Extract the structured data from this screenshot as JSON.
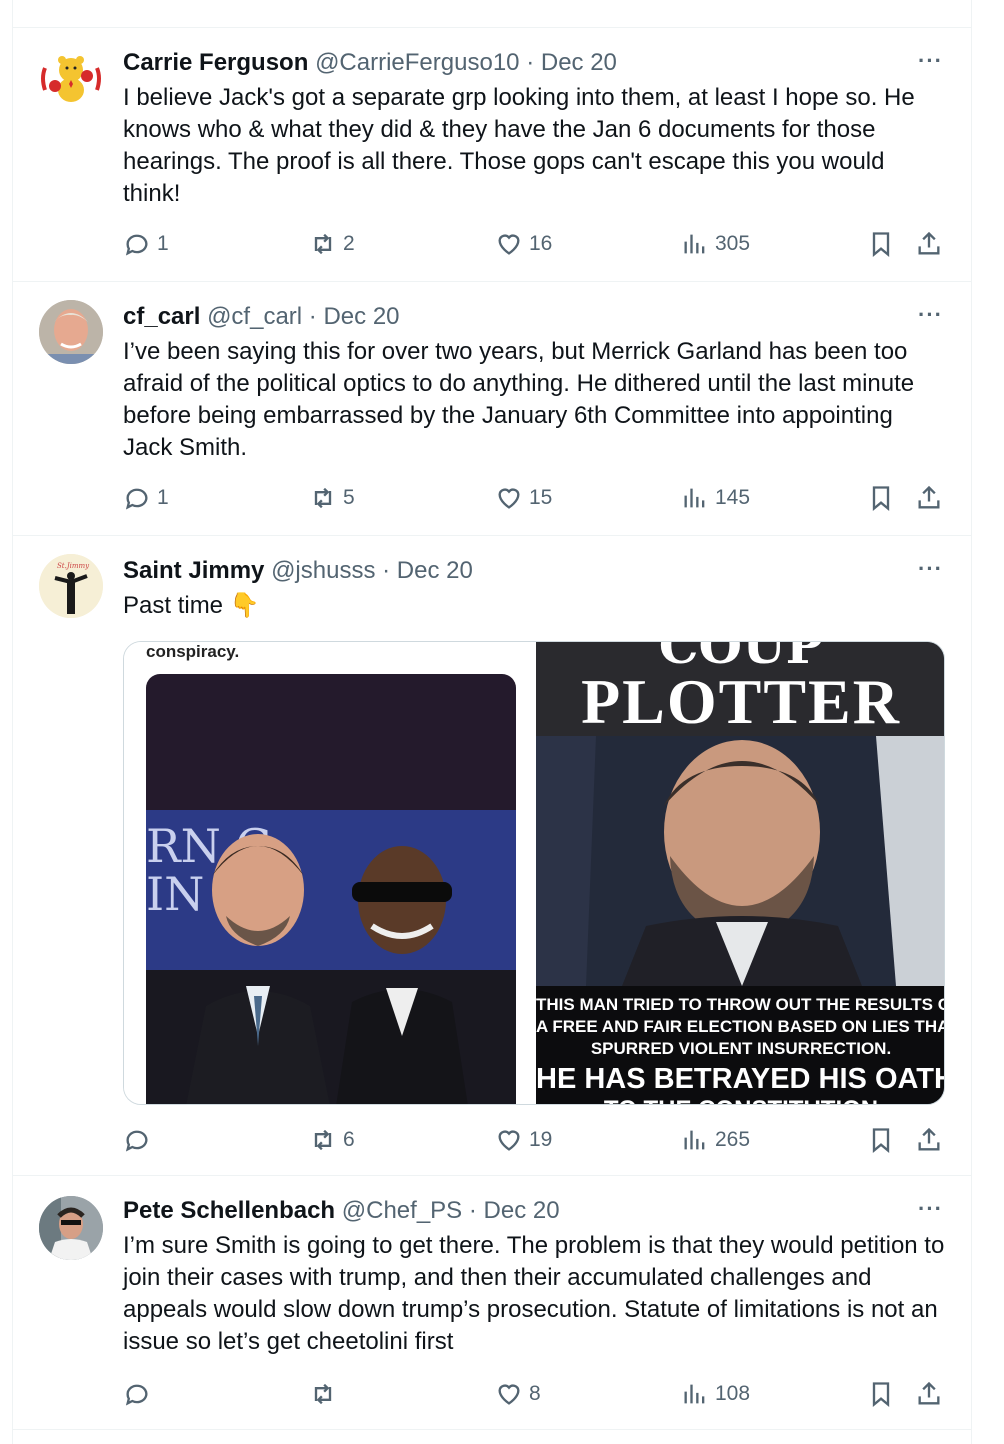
{
  "tweets": [
    {
      "display_name": "Carrie Ferguson",
      "handle": "@CarrieFerguso10",
      "sep": "·",
      "date": "Dec 20",
      "text": "I believe Jack's got a separate grp looking into them, at least I hope so. He knows who & what they did & they have the Jan 6 documents for those hearings. The proof is all there. Those gops can't escape this you would think!",
      "replies": "1",
      "reposts": "2",
      "likes": "16",
      "views": "305"
    },
    {
      "display_name": "cf_carl",
      "handle": "@cf_carl",
      "sep": "·",
      "date": "Dec 20",
      "text": "I’ve been saying this for over two years, but Merrick Garland has been too afraid of the political optics to do anything. He dithered until the last minute before being embarrassed by the January 6th Committee into appointing Jack Smith.",
      "replies": "1",
      "reposts": "5",
      "likes": "15",
      "views": "145"
    },
    {
      "display_name": "Saint Jimmy",
      "handle": "@jshusss",
      "sep": "·",
      "date": "Dec 20",
      "text": "Past time 👇",
      "replies": "",
      "reposts": "6",
      "likes": "19",
      "views": "265",
      "media": {
        "left_caption": "conspiracy.",
        "banner_fragment_left": "RN  G",
        "banner_fragment_left2": "IN    SA",
        "right_title_top": "COUP",
        "right_title": "PLOTTER",
        "right_text_1": "THIS MAN TRIED TO THROW OUT THE RESULTS OF",
        "right_text_2": "A FREE AND FAIR ELECTION BASED ON LIES THAT",
        "right_text_3": "SPURRED VIOLENT INSURRECTION.",
        "right_text_big": "HE HAS BETRAYED HIS OATH",
        "right_text_cut": "TO THE CONSTITUTION"
      }
    },
    {
      "display_name": "Pete Schellenbach",
      "handle": "@Chef_PS",
      "sep": "·",
      "date": "Dec 20",
      "text": "I’m sure Smith is going to get there. The problem is that they would petition to join their cases with trump, and then their accumulated challenges and appeals would slow down trump’s prosecution. Statute of limitations is not an issue so let’s get cheetolini first",
      "replies": "",
      "reposts": "",
      "likes": "8",
      "views": "108"
    }
  ],
  "more_glyph": "···",
  "colors": {
    "text": "#0f1419",
    "muted": "#536471",
    "border": "#eff3f4"
  },
  "icons": [
    "reply-icon",
    "repost-icon",
    "like-icon",
    "views-icon",
    "bookmark-icon",
    "share-icon",
    "more-icon"
  ]
}
